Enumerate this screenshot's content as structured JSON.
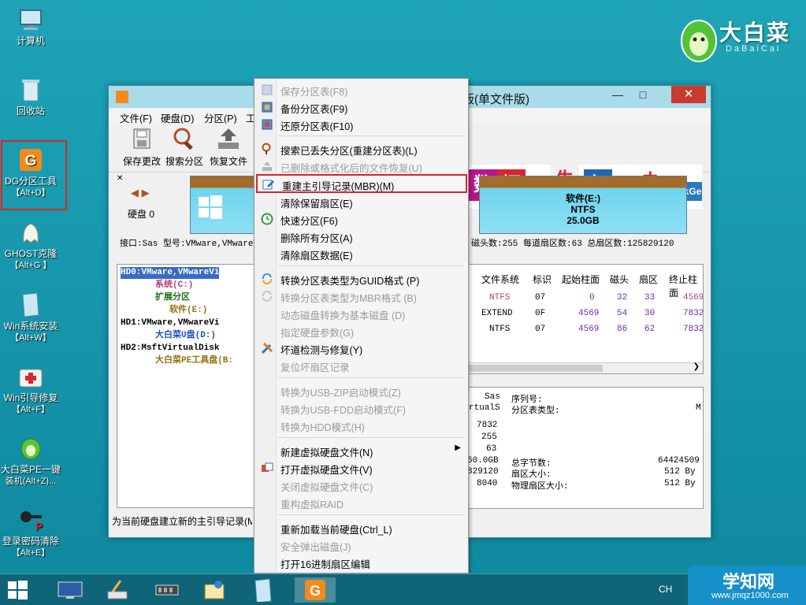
{
  "desktop": {
    "icons": [
      {
        "label": "计算机",
        "sub": ""
      },
      {
        "label": "回收站",
        "sub": ""
      },
      {
        "label": "DG分区工具",
        "sub": "【Alt+D】"
      },
      {
        "label": "GHOST克隆",
        "sub": "【Alt+G 】"
      },
      {
        "label": "Win系统安装",
        "sub": "【Alt+W】"
      },
      {
        "label": "Win引导修复",
        "sub": "【Alt+F】"
      },
      {
        "label": "大白菜PE一键",
        "sub": "装机(Alt+Z)..."
      },
      {
        "label": "登录密码清除",
        "sub": "【Alt+E】"
      }
    ],
    "logo_cn": "大白菜",
    "logo_en": "DaBaiCai"
  },
  "window": {
    "title": "版(单文件版)",
    "menu": [
      "文件(F)",
      "硬盘(D)",
      "分区(P)",
      "工"
    ],
    "toolbar": [
      "保存更改",
      "搜索分区",
      "恢复文件"
    ],
    "banner_chars": [
      "数",
      "据",
      "丢",
      "失",
      "怎",
      "么",
      "办",
      "!"
    ],
    "banner_brand": "DiskGeni",
    "disk_label": "硬盘 0",
    "partition": {
      "name": "软件(E:)",
      "fs": "NTFS",
      "size": "25.0GB"
    },
    "info_left": "接口:Sas  型号:VMware,VMwareVi",
    "info_right": "磁头数:255  每道扇区数:63  总扇区数:125829120",
    "tree": [
      "HD0:VMware,VMwareVi",
      "系统(C:)",
      "扩展分区",
      "软件(E:)",
      "HD1:VMware,VMwareVi",
      "大白菜U盘(D:)",
      "HD2:MsftVirtualDisk",
      "大白菜PE工具盘(B:"
    ],
    "table": {
      "headers": [
        "文件系统",
        "标识",
        "起始柱面",
        "磁头",
        "扇区",
        "终止柱面"
      ],
      "rows": [
        [
          "NTFS",
          "07",
          "0",
          "32",
          "33",
          "4569"
        ],
        [
          "EXTEND",
          "0F",
          "4569",
          "54",
          "30",
          "7832"
        ],
        [
          "NTFS",
          "07",
          "4569",
          "86",
          "62",
          "7832"
        ]
      ]
    },
    "details": {
      "left_col": [
        "Sas",
        "rtualS",
        "7832",
        "255",
        "63",
        "60.0GB",
        "829120",
        "8040"
      ],
      "labels": [
        "序列号:",
        "分区表类型:",
        "总字节数:",
        "扇区大小:",
        "物理扇区大小:"
      ],
      "values": [
        "M",
        "64424509",
        "512 By",
        "512 By"
      ]
    },
    "status": "为当前硬盘建立新的主引导记录(M"
  },
  "context_menu": {
    "items": [
      {
        "label": "保存分区表(F8)",
        "disabled": true
      },
      {
        "label": "备份分区表(F9)",
        "disabled": false
      },
      {
        "label": "还原分区表(F10)",
        "disabled": false
      },
      {
        "label": "搜索已丢失分区(重建分区表)(L)",
        "disabled": false
      },
      {
        "label": "已删除或格式化后的文件恢复(U)",
        "disabled": true
      },
      {
        "label": "重建主引导记录(MBR)(M)",
        "disabled": false
      },
      {
        "label": "清除保留扇区(E)",
        "disabled": false
      },
      {
        "label": "快速分区(F6)",
        "disabled": false
      },
      {
        "label": "删除所有分区(A)",
        "disabled": false
      },
      {
        "label": "清除扇区数据(E)",
        "disabled": false
      },
      {
        "label": "转换分区表类型为GUID格式 (P)",
        "disabled": false
      },
      {
        "label": "转换分区表类型为MBR格式 (B)",
        "disabled": true
      },
      {
        "label": "动态磁盘转换为基本磁盘 (D)",
        "disabled": true
      },
      {
        "label": "指定硬盘参数(G)",
        "disabled": true
      },
      {
        "label": "坏道检测与修复(Y)",
        "disabled": false
      },
      {
        "label": "复位坏扇区记录",
        "disabled": true
      },
      {
        "label": "转换为USB-ZIP启动模式(Z)",
        "disabled": true
      },
      {
        "label": "转换为USB-FDD启动模式(F)",
        "disabled": true
      },
      {
        "label": "转换为HDD模式(H)",
        "disabled": true
      },
      {
        "label": "新建虚拟硬盘文件(N)",
        "disabled": false
      },
      {
        "label": "打开虚拟硬盘文件(V)",
        "disabled": false
      },
      {
        "label": "关闭虚拟硬盘文件(C)",
        "disabled": true
      },
      {
        "label": "重构虚拟RAID",
        "disabled": true
      },
      {
        "label": "重新加载当前硬盘(Ctrl_L)",
        "disabled": false
      },
      {
        "label": "安全弹出磁盘(J)",
        "disabled": true
      },
      {
        "label": "打开16进制扇区编辑",
        "disabled": false
      }
    ]
  },
  "taskbar": {
    "ime": "CH"
  },
  "watermark": {
    "name": "学知网",
    "url": "www.jmqz1000.com"
  },
  "colors": {
    "accent": "#f28a1d",
    "highlight": "#d6272b",
    "desktop": "#1797ad"
  }
}
